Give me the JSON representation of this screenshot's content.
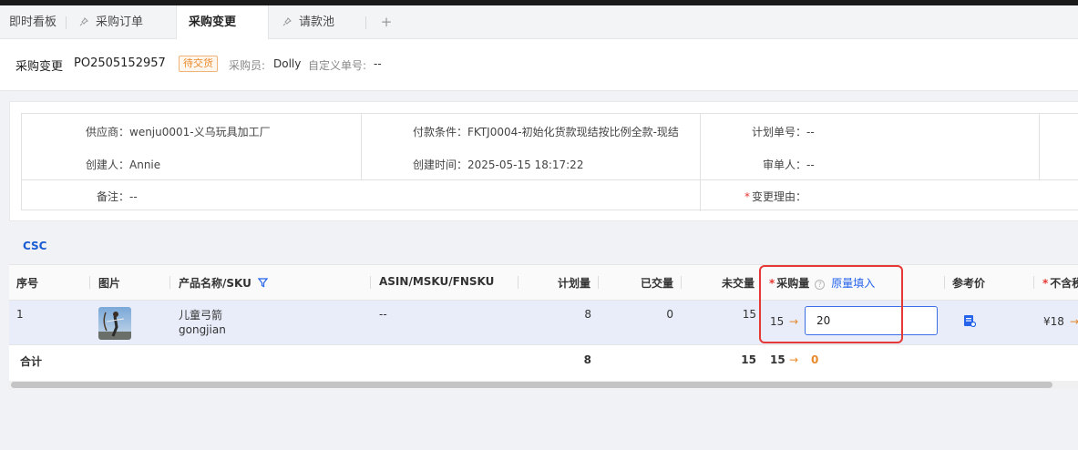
{
  "tabs": [
    {
      "label": "即时看板",
      "pinned": false,
      "active": false
    },
    {
      "label": "采购订单",
      "pinned": true,
      "active": false
    },
    {
      "label": "采购变更",
      "pinned": false,
      "active": true
    },
    {
      "label": "请款池",
      "pinned": true,
      "active": false
    }
  ],
  "tab_add": "+",
  "header": {
    "title": "采购变更",
    "po_number": "PO2505152957",
    "status": "待交货",
    "buyer_label": "采购员:",
    "buyer": "Dolly",
    "custom_no_label": "自定义单号:",
    "custom_no": "--"
  },
  "info": {
    "supplier": "供应商：wenju0001-义乌玩具加工厂",
    "payment": "付款条件：FKTJ0004-初始化货款现结按比例全款-现结",
    "plan_no": "计划单号：--",
    "creator": "创建人：Annie",
    "created_time": "创建时间：2025-05-15 18:17:22",
    "reviewer": "审单人：--",
    "remark": "备注：--",
    "change_reason": "变更理由："
  },
  "section_label": "CSC",
  "table": {
    "columns": {
      "seq": "序号",
      "image": "图片",
      "product": "产品名称/SKU",
      "asin": "ASIN/MSKU/FNSKU",
      "planned": "计划量",
      "delivered": "已交量",
      "undelivered": "未交量",
      "purchase_qty": "采购量",
      "fill_original": "原量填入",
      "ref_price": "参考价",
      "excl_tax": "不含税"
    },
    "row": {
      "seq": "1",
      "product_name": "儿童弓箭",
      "sku": "gongjian",
      "asin": "--",
      "planned": "8",
      "delivered": "0",
      "undelivered": "15",
      "purchase_qty_old": "15",
      "arrow": "→",
      "purchase_qty_new": "20",
      "excl_tax_old": "¥18"
    },
    "total": {
      "label": "合计",
      "planned": "8",
      "undelivered": "15",
      "purchase_old": "15",
      "purchase_new": "0"
    }
  },
  "colors": {
    "accent": "#2563eb",
    "highlight": "#e53935",
    "orange": "#e8892b"
  }
}
